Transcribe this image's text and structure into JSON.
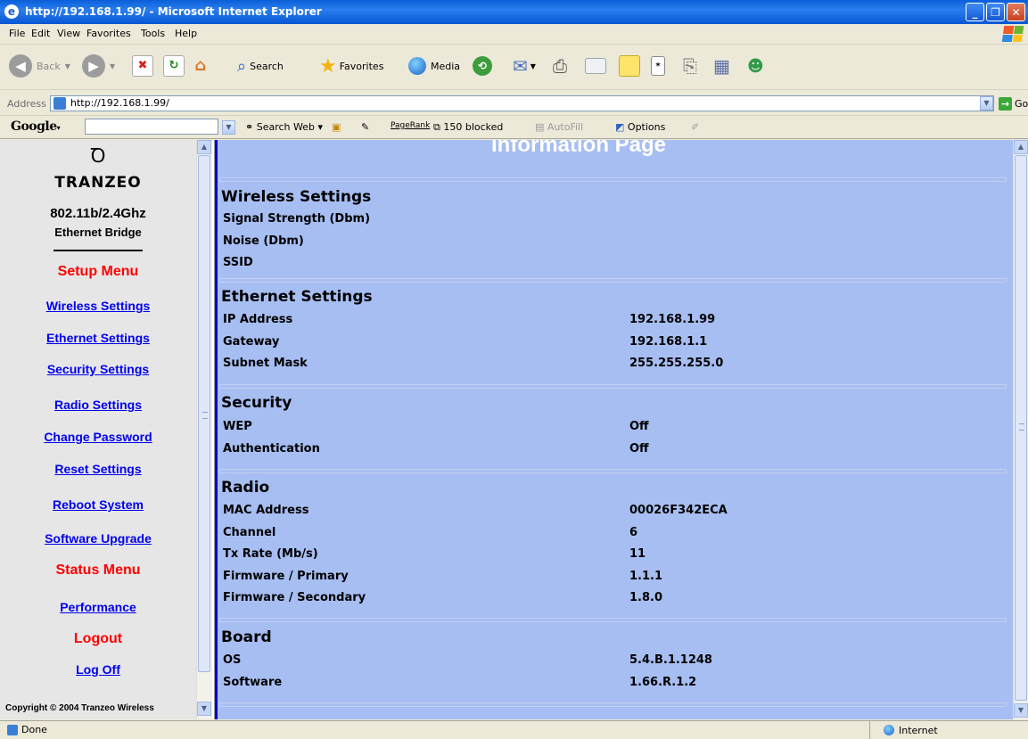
{
  "window": {
    "title": "http://192.168.1.99/ - Microsoft Internet Explorer"
  },
  "menu": [
    "File",
    "Edit",
    "View",
    "Favorites",
    "Tools",
    "Help"
  ],
  "toolbar": {
    "back": "Back",
    "search": "Search",
    "favorites": "Favorites",
    "media": "Media"
  },
  "address": {
    "label": "Address",
    "url": "http://192.168.1.99/",
    "go": "Go"
  },
  "google": {
    "logo": "Google",
    "search_web": "Search Web",
    "pagerank": "PageRank",
    "blocked": "150 blocked",
    "autofill": "AutoFill",
    "options": "Options"
  },
  "sidebar": {
    "brand": "TRANZEO",
    "model": "802.11b/2.4Ghz",
    "model_sub": "Ethernet Bridge",
    "setup_heading": "Setup Menu",
    "setup_links": [
      "Wireless Settings",
      "Ethernet Settings",
      "Security Settings",
      "Radio Settings",
      "Change Password",
      "Reset Settings",
      "Reboot System",
      "Software Upgrade"
    ],
    "status_heading": "Status Menu",
    "status_links": [
      "Performance"
    ],
    "logout_heading": "Logout",
    "logout_links": [
      "Log Off"
    ],
    "copyright": "Copyright © 2004 Tranzeo Wireless"
  },
  "main": {
    "page_title": "Information Page",
    "wireless": {
      "heading": "Wireless Settings",
      "rows": [
        {
          "label": "Signal Strength (Dbm)",
          "value": ""
        },
        {
          "label": "Noise (Dbm)",
          "value": ""
        },
        {
          "label": "SSID",
          "value": ""
        }
      ]
    },
    "ethernet": {
      "heading": "Ethernet Settings",
      "rows": [
        {
          "label": "IP Address",
          "value": "192.168.1.99"
        },
        {
          "label": "Gateway",
          "value": "192.168.1.1"
        },
        {
          "label": "Subnet Mask",
          "value": "255.255.255.0"
        }
      ]
    },
    "security": {
      "heading": "Security",
      "rows": [
        {
          "label": "WEP",
          "value": "Off"
        },
        {
          "label": "Authentication",
          "value": "Off"
        }
      ]
    },
    "radio": {
      "heading": "Radio",
      "rows": [
        {
          "label": "MAC Address",
          "value": "00026F342ECA"
        },
        {
          "label": "Channel",
          "value": "6"
        },
        {
          "label": "Tx Rate (Mb/s)",
          "value": "11"
        },
        {
          "label": "Firmware / Primary",
          "value": "1.1.1"
        },
        {
          "label": "Firmware / Secondary",
          "value": "1.8.0"
        }
      ]
    },
    "board": {
      "heading": "Board",
      "rows": [
        {
          "label": "OS",
          "value": "5.4.B.1.1248"
        },
        {
          "label": "Software",
          "value": "1.66.R.1.2"
        }
      ]
    }
  },
  "status": {
    "text": "Done",
    "zone": "Internet"
  }
}
